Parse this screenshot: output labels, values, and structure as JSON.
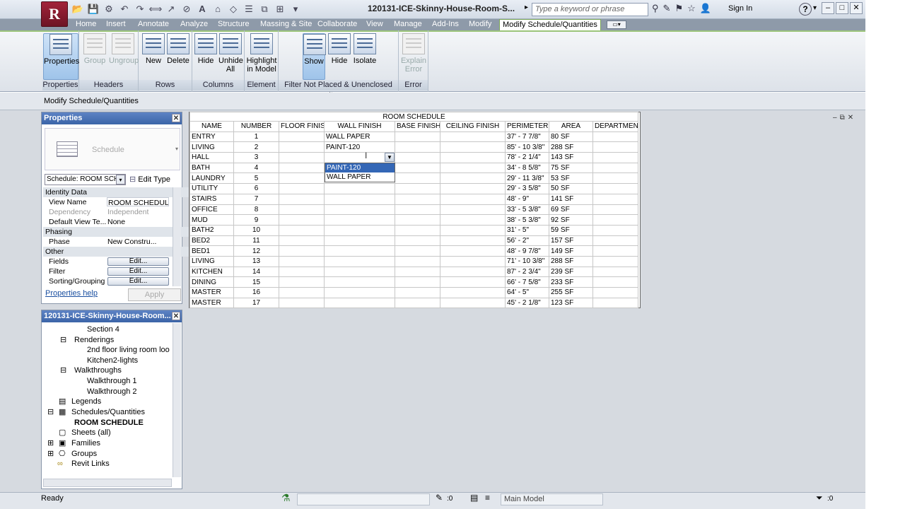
{
  "window": {
    "title": "120131-ICE-Skinny-House-Room-S...",
    "search_placeholder": "Type a keyword or phrase",
    "sign_in": "Sign In",
    "help": "?"
  },
  "tabs": [
    "Home",
    "Insert",
    "Annotate",
    "Analyze",
    "Structure",
    "Massing & Site",
    "Collaborate",
    "View",
    "Manage",
    "Add-Ins",
    "Modify",
    "Modify Schedule/Quantities"
  ],
  "ribbon": {
    "panels": [
      {
        "label": "Properties",
        "buttons": [
          "Properties"
        ]
      },
      {
        "label": "Headers",
        "buttons": [
          "Group",
          "Ungroup"
        ]
      },
      {
        "label": "Rows",
        "buttons": [
          "New",
          "Delete"
        ]
      },
      {
        "label": "Columns",
        "buttons": [
          "Hide",
          "Unhide All"
        ]
      },
      {
        "label": "Element",
        "buttons": [
          "Highlight in Model"
        ]
      },
      {
        "label": "Filter Not Placed & Unenclosed Items",
        "buttons": [
          "Show",
          "Hide",
          "Isolate"
        ]
      },
      {
        "label": "Error",
        "buttons": [
          "Explain Error"
        ]
      }
    ]
  },
  "options_bar": "Modify Schedule/Quantities",
  "properties": {
    "title": "Properties",
    "type_name": "Schedule",
    "selector": "Schedule: ROOM SCH",
    "edit_type": "Edit Type",
    "groups": {
      "identity": "Identity Data",
      "phasing": "Phasing",
      "other": "Other"
    },
    "rows": {
      "view_name": {
        "k": "View Name",
        "v": "ROOM SCHEDULE"
      },
      "dependency": {
        "k": "Dependency",
        "v": "Independent"
      },
      "default_template": {
        "k": "Default View Te...",
        "v": "None"
      },
      "phase": {
        "k": "Phase",
        "v": "New Constru..."
      },
      "fields": {
        "k": "Fields",
        "v": "Edit..."
      },
      "filter": {
        "k": "Filter",
        "v": "Edit..."
      },
      "sorting": {
        "k": "Sorting/Grouping",
        "v": "Edit..."
      }
    },
    "help": "Properties help",
    "apply": "Apply"
  },
  "browser": {
    "title": "120131-ICE-Skinny-House-Room...",
    "nodes": [
      "Section 4",
      "Renderings",
      "2nd floor living room loo",
      "Kitchen2-lights",
      "Walkthroughs",
      "Walkthrough 1",
      "Walkthrough 2",
      "Legends",
      "Schedules/Quantities",
      "ROOM SCHEDULE",
      "Sheets (all)",
      "Families",
      "Groups",
      "Revit Links"
    ]
  },
  "schedule": {
    "title": "ROOM SCHEDULE",
    "columns": [
      "NAME",
      "NUMBER",
      "FLOOR FINIS",
      "WALL FINISH",
      "BASE FINISH",
      "CEILING FINISH",
      "PERIMETER",
      "AREA",
      "DEPARTMENT"
    ],
    "rows": [
      [
        "ENTRY",
        "1",
        "",
        "WALL PAPER",
        "",
        "",
        "37' - 7 7/8\"",
        "80 SF",
        ""
      ],
      [
        "LIVING",
        "2",
        "",
        "PAINT-120",
        "",
        "",
        "85' - 10 3/8\"",
        "288 SF",
        ""
      ],
      [
        "HALL",
        "3",
        "",
        "",
        "",
        "",
        "78' - 2 1/4\"",
        "143 SF",
        ""
      ],
      [
        "BATH",
        "4",
        "",
        "",
        "",
        "",
        "34' - 8 5/8\"",
        "75 SF",
        ""
      ],
      [
        "LAUNDRY",
        "5",
        "",
        "",
        "",
        "",
        "29' - 11 3/8\"",
        "53 SF",
        ""
      ],
      [
        "UTILITY",
        "6",
        "",
        "",
        "",
        "",
        "29' - 3 5/8\"",
        "50 SF",
        ""
      ],
      [
        "STAIRS",
        "7",
        "",
        "",
        "",
        "",
        "48' - 9\"",
        "141 SF",
        ""
      ],
      [
        "OFFICE",
        "8",
        "",
        "",
        "",
        "",
        "33' - 5 3/8\"",
        "69 SF",
        ""
      ],
      [
        "MUD",
        "9",
        "",
        "",
        "",
        "",
        "38' - 5 3/8\"",
        "92 SF",
        ""
      ],
      [
        "BATH2",
        "10",
        "",
        "",
        "",
        "",
        "31' - 5\"",
        "59 SF",
        ""
      ],
      [
        "BED2",
        "11",
        "",
        "",
        "",
        "",
        "56' - 2\"",
        "157 SF",
        ""
      ],
      [
        "BED1",
        "12",
        "",
        "",
        "",
        "",
        "48' - 9 7/8\"",
        "149 SF",
        ""
      ],
      [
        "LIVING",
        "13",
        "",
        "",
        "",
        "",
        "71' - 10 3/8\"",
        "288 SF",
        ""
      ],
      [
        "KITCHEN",
        "14",
        "",
        "",
        "",
        "",
        "87' - 2 3/4\"",
        "239 SF",
        ""
      ],
      [
        "DINING",
        "15",
        "",
        "",
        "",
        "",
        "66' - 7 5/8\"",
        "233 SF",
        ""
      ],
      [
        "MASTER",
        "16",
        "",
        "",
        "",
        "",
        "64' - 5\"",
        "255 SF",
        ""
      ],
      [
        "MASTER",
        "17",
        "",
        "",
        "",
        "",
        "45' - 2 1/8\"",
        "123 SF",
        ""
      ]
    ],
    "dropdown_options": [
      "PAINT-120",
      "WALL PAPER"
    ]
  },
  "status": {
    "text": "Ready",
    "count1": ":0",
    "model": "Main Model",
    "count2": ":0"
  }
}
